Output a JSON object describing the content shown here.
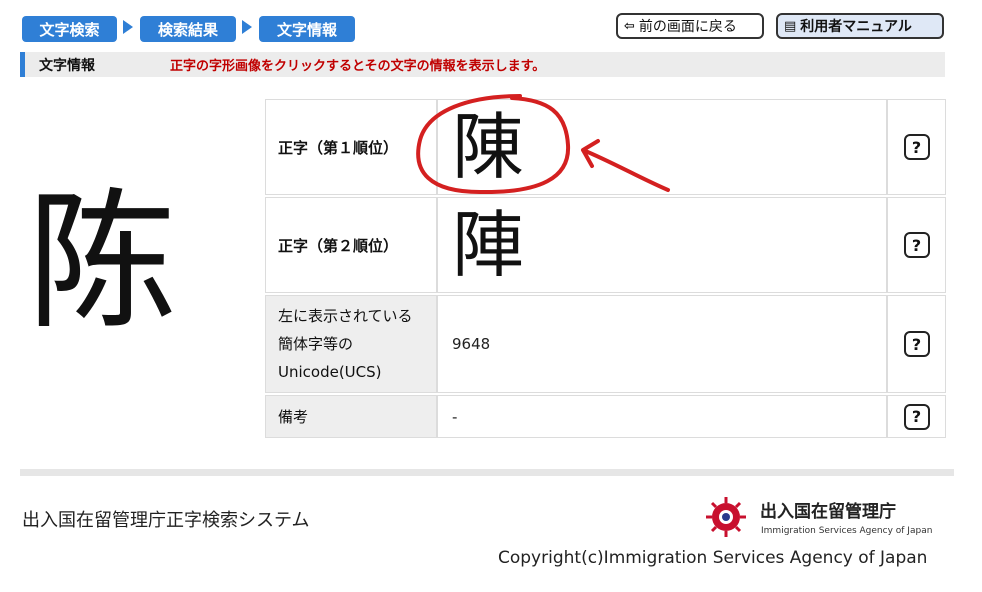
{
  "breadcrumb": [
    "文字検索",
    "検索結果",
    "文字情報"
  ],
  "header": {
    "back_label": "前の画面に戻る",
    "manual_label": "利用者マニュアル"
  },
  "section": {
    "title": "文字情報",
    "message": "正字の字形画像をクリックするとその文字の情報を表示します。"
  },
  "character": "陈",
  "table": {
    "rows": [
      {
        "label": "正字（第１順位）",
        "value": "陳",
        "help": "?"
      },
      {
        "label": "正字（第２順位）",
        "value": "陣",
        "help": "?"
      },
      {
        "label": "左に表示されている簡体字等のUnicode(UCS)",
        "value": "9648",
        "help": "?"
      },
      {
        "label": "備考",
        "value": "-",
        "help": "?"
      }
    ]
  },
  "footer": {
    "system_name": "出入国在留管理庁正字検索システム",
    "agency_jp": "出入国在留管理庁",
    "agency_en": "Immigration Services Agency of Japan",
    "copyright": "Copyright(c)Immigration Services Agency of Japan"
  },
  "colors": {
    "accent": "#2f7fd6",
    "message": "#c00000",
    "annotation": "#d42020"
  },
  "icons": [
    "arrow-left-icon",
    "manual-book-icon",
    "help-icon",
    "agency-emblem-icon"
  ]
}
